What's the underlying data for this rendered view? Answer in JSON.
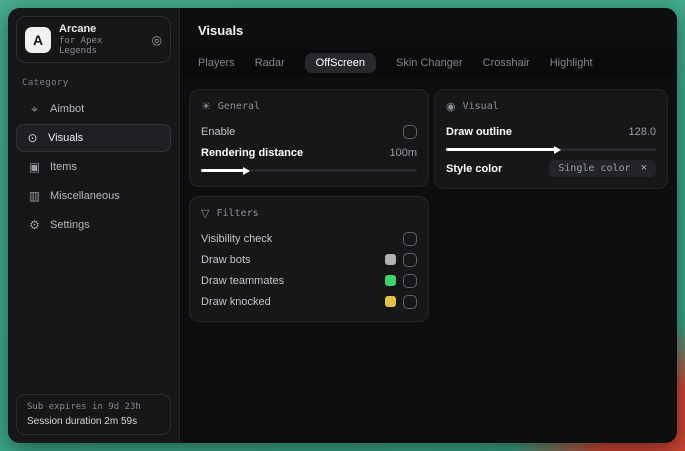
{
  "window": {
    "app_name": "Arcane",
    "app_subtitle": "for Apex Legends",
    "logo_letter": "A"
  },
  "icons": {
    "pin": "◎",
    "aimbot": "⌖",
    "visuals": "⊙",
    "items": "▣",
    "miscellaneous": "▥",
    "settings": "⚙",
    "general": "☀",
    "filters": "▽",
    "visual": "◉",
    "remove": "×"
  },
  "sidebar": {
    "category_label": "Category",
    "items": [
      {
        "label": "Aimbot",
        "active": false
      },
      {
        "label": "Visuals",
        "active": true
      },
      {
        "label": "Items",
        "active": false
      },
      {
        "label": "Miscellaneous",
        "active": false
      },
      {
        "label": "Settings",
        "active": false
      }
    ],
    "footer": {
      "line1": "Sub expires in 9d 23h",
      "line2": "Session duration 2m 59s"
    }
  },
  "main": {
    "title": "Visuals",
    "tabs": [
      {
        "label": "Players",
        "active": false
      },
      {
        "label": "Radar",
        "active": false
      },
      {
        "label": "OffScreen",
        "active": true
      },
      {
        "label": "Skin Changer",
        "active": false
      },
      {
        "label": "Crosshair",
        "active": false
      },
      {
        "label": "Highlight",
        "active": false
      }
    ]
  },
  "panels": {
    "general": {
      "title": "General",
      "enable_label": "Enable",
      "enable_checked": false,
      "rendering_label": "Rendering distance",
      "rendering_value": "100m",
      "rendering_fill": "20%"
    },
    "filters": {
      "title": "Filters",
      "rows": [
        {
          "label": "Visibility check",
          "checked": false
        },
        {
          "label": "Draw bots",
          "swatch": "#b3b3b3",
          "checked": false
        },
        {
          "label": "Draw teammates",
          "swatch": "#3ed46c",
          "checked": false
        },
        {
          "label": "Draw knocked",
          "swatch": "#e2c14c",
          "checked": false
        }
      ]
    },
    "visual": {
      "title": "Visual",
      "outline_label": "Draw outline",
      "outline_value": "128.0",
      "outline_fill": "52%",
      "style_label": "Style color",
      "style_value": "Single color"
    }
  },
  "colors": {
    "accent_teal": "#3da88b",
    "accent_red": "#cb4532",
    "swatch_gray": "#b3b3b3",
    "swatch_green": "#3ed46c",
    "swatch_yellow": "#e2c14c"
  }
}
